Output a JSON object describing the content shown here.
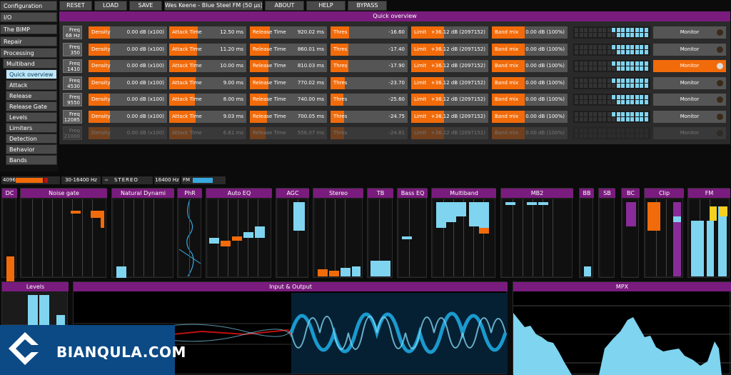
{
  "nav": [
    {
      "label": "Configuration",
      "level": 1
    },
    {
      "label": "I/O",
      "level": 1
    },
    {
      "label": "The BIMP",
      "level": 1
    },
    {
      "label": "Repair",
      "level": 1
    },
    {
      "label": "Processing",
      "level": 1
    },
    {
      "label": "Multiband",
      "level": 2
    },
    {
      "label": "Quick overview",
      "level": 3,
      "active": true
    },
    {
      "label": "Attack",
      "level": 3
    },
    {
      "label": "Release",
      "level": 3
    },
    {
      "label": "Release Gate",
      "level": 3
    },
    {
      "label": "Levels",
      "level": 3
    },
    {
      "label": "Limiters",
      "level": 3
    },
    {
      "label": "Detection",
      "level": 3
    },
    {
      "label": "Behavior",
      "level": 3
    },
    {
      "label": "Bands",
      "level": 3
    }
  ],
  "topbar": {
    "reset": "RESET",
    "load": "LOAD",
    "save": "SAVE",
    "preset": "Wes Keene - Blue Steel FM (50 µs)",
    "about": "ABOUT",
    "help": "HELP",
    "bypass": "BYPASS"
  },
  "quick_overview": {
    "title": "Quick overview",
    "labels": {
      "density": "Density",
      "attack": "Attack Time",
      "release": "Release Time",
      "thres": "Thres",
      "limit": "Limit",
      "bandmix": "Band mix",
      "monitor": "Monitor"
    },
    "rows": [
      {
        "freq_label": "Freq",
        "freq": "68 Hz",
        "density": "0.00 dB (x100)",
        "attack": "12.50 ms",
        "release": "920.02 ms",
        "thres": "-16.60",
        "limit": "+36.12 dB (2097152)",
        "bandmix": "0.00 dB (100%)",
        "monitor_on": false,
        "dim": false,
        "fills": {
          "density": 0.55,
          "attack": 0.8,
          "release": 0.5,
          "thres": 0.45,
          "limit": 1,
          "bandmix": 1
        },
        "meter": 0.7
      },
      {
        "freq_label": "Freq",
        "freq": "350",
        "density": "0.00 dB (x100)",
        "attack": "11.20 ms",
        "release": "860.01 ms",
        "thres": "-17.40",
        "limit": "+36.12 dB (2097152)",
        "bandmix": "0.00 dB (100%)",
        "monitor_on": false,
        "dim": false,
        "fills": {
          "density": 0.55,
          "attack": 0.78,
          "release": 0.48,
          "thres": 0.43,
          "limit": 1,
          "bandmix": 1
        },
        "meter": 0.66
      },
      {
        "freq_label": "Freq",
        "freq": "1410",
        "density": "0.00 dB (x100)",
        "attack": "10.00 ms",
        "release": "810.03 ms",
        "thres": "-17.90",
        "limit": "+36.12 dB (2097152)",
        "bandmix": "0.00 dB (100%)",
        "monitor_on": true,
        "dim": false,
        "fills": {
          "density": 0.55,
          "attack": 0.75,
          "release": 0.46,
          "thres": 0.42,
          "limit": 1,
          "bandmix": 1
        },
        "meter": 0.68
      },
      {
        "freq_label": "Freq",
        "freq": "4530",
        "density": "0.00 dB (x100)",
        "attack": "9.00 ms",
        "release": "770.02 ms",
        "thres": "-23.70",
        "limit": "+36.12 dB (2097152)",
        "bandmix": "0.00 dB (100%)",
        "monitor_on": false,
        "dim": false,
        "fills": {
          "density": 0.55,
          "attack": 0.72,
          "release": 0.44,
          "thres": 0.3,
          "limit": 1,
          "bandmix": 1
        },
        "meter": 0.64
      },
      {
        "freq_label": "Freq",
        "freq": "9550",
        "density": "0.00 dB (x100)",
        "attack": "8.00 ms",
        "release": "740.00 ms",
        "thres": "-25.60",
        "limit": "+36.12 dB (2097152)",
        "bandmix": "0.00 dB (100%)",
        "monitor_on": false,
        "dim": false,
        "fills": {
          "density": 0.55,
          "attack": 0.7,
          "release": 0.42,
          "thres": 0.26,
          "limit": 1,
          "bandmix": 1
        },
        "meter": 0.62
      },
      {
        "freq_label": "Freq",
        "freq": "12085",
        "density": "0.00 dB (x100)",
        "attack": "9.03 ms",
        "release": "700.05 ms",
        "thres": "-24.75",
        "limit": "+36.12 dB (2097152)",
        "bandmix": "0.00 dB (100%)",
        "monitor_on": false,
        "dim": false,
        "fills": {
          "density": 0.55,
          "attack": 0.73,
          "release": 0.4,
          "thres": 0.28,
          "limit": 1,
          "bandmix": 1
        },
        "meter": 0.6
      },
      {
        "freq_label": "Freq",
        "freq": "21000",
        "density": "0.00 dB (x100)",
        "attack": "6.81 ms",
        "release": "556.07 ms",
        "thres": "-24.81",
        "limit": "+36.12 dB (2097152)",
        "bandmix": "0.00 dB (100%)",
        "monitor_on": false,
        "dim": true,
        "fills": {
          "density": 0.55,
          "attack": 0.6,
          "release": 0.35,
          "thres": 0.28,
          "limit": 1,
          "bandmix": 1
        },
        "meter": 0
      }
    ]
  },
  "status": {
    "rate": "4096",
    "range": "30-16400 Hz",
    "stereo": "STEREO",
    "hz": "16400 Hz",
    "fm": "FM"
  },
  "modules": [
    {
      "name": "DC"
    },
    {
      "name": "Noise gate"
    },
    {
      "name": "Natural Dynami"
    },
    {
      "name": "PhR"
    },
    {
      "name": "Auto EQ"
    },
    {
      "name": "AGC"
    },
    {
      "name": "Stereo"
    },
    {
      "name": "TB"
    },
    {
      "name": "Bass EQ"
    },
    {
      "name": "Multiband"
    },
    {
      "name": "MB2"
    },
    {
      "name": "BB"
    },
    {
      "name": "SB"
    },
    {
      "name": "BC"
    },
    {
      "name": "Clip"
    },
    {
      "name": "FM"
    }
  ],
  "bottom": {
    "levels": "Levels",
    "io": "Input & Output",
    "mpx": "MPX"
  },
  "logo": {
    "text": "BIANQULA.COM"
  },
  "colors": {
    "accent": "#f26b0a",
    "meter": "#7fd4f0",
    "panel": "#7a1c7e"
  }
}
